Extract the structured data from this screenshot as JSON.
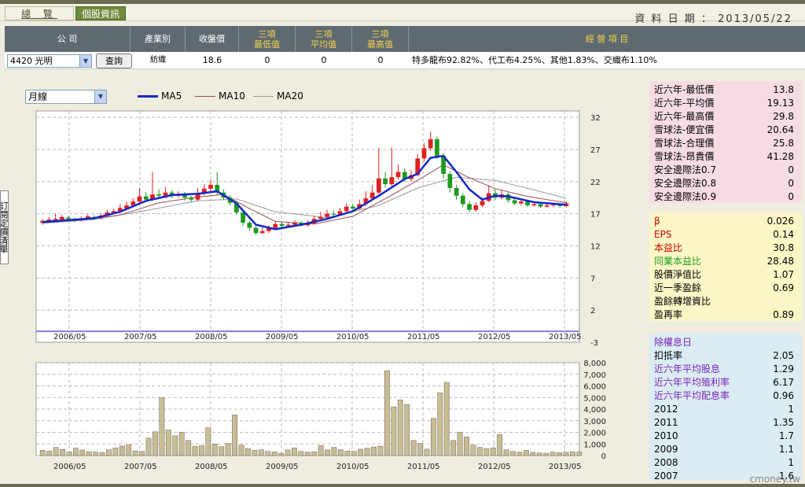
{
  "tabs": {
    "overview": "總 覽",
    "stock_info": "個股資訊"
  },
  "data_date_label": "資 料 日 期 ：",
  "data_date": "2013/05/22",
  "header": {
    "company": "公 司",
    "industry": "產業別",
    "close": "收盤價",
    "three_low": "三項\n最低值",
    "three_avg": "三項\n平均值",
    "three_high": "三項\n最高值",
    "business": "經 營 項 目"
  },
  "row": {
    "stock_select": "4420 光明",
    "query_button": "查詢",
    "industry": "紡織",
    "close": "18.6",
    "three_low": "0",
    "three_avg": "0",
    "three_high": "0",
    "business": "特多龍布92.82%、代工布4.25%、其他1.83%、交織布1.10%"
  },
  "left_tab": "訂閱定價清單",
  "period_select": "月線",
  "legend": [
    "MA5",
    "MA10",
    "MA20"
  ],
  "side": {
    "panel1": [
      {
        "label": "近六年-最低價",
        "value": "13.8"
      },
      {
        "label": "近六年-平均價",
        "value": "19.13"
      },
      {
        "label": "近六年-最高價",
        "value": "29.8"
      },
      {
        "label": "雪球法-便宜價",
        "value": "20.64"
      },
      {
        "label": "雪球法-合理價",
        "value": "25.8"
      },
      {
        "label": "雪球法-昂貴價",
        "value": "41.28"
      },
      {
        "label": "安全邊際法0.7",
        "value": "0"
      },
      {
        "label": "安全邊際法0.8",
        "value": "0"
      },
      {
        "label": "安全邊際法0.9",
        "value": "0"
      }
    ],
    "panel2": [
      {
        "label": "β",
        "value": "0.026"
      },
      {
        "label": "EPS",
        "value": "0.14"
      },
      {
        "label": "本益比",
        "value": "30.8"
      },
      {
        "label": "同業本益比",
        "value": "28.48"
      },
      {
        "label": "股價淨值比",
        "value": "1.07"
      },
      {
        "label": "近一季盈餘",
        "value": "0.69"
      },
      {
        "label": "盈餘轉增資比",
        "value": ""
      },
      {
        "label": "盈再率",
        "value": "0.89"
      }
    ],
    "panel3_title": "除權息日",
    "panel3": [
      {
        "label": "扣抵率",
        "value": "2.05"
      },
      {
        "label": "近六年平均股息",
        "value": "1.29"
      },
      {
        "label": "近六年平均殖利率",
        "value": "6.17"
      },
      {
        "label": "近六年平均配息率",
        "value": "0.96"
      },
      {
        "label": "2012",
        "value": "1"
      },
      {
        "label": "2011",
        "value": "1.35"
      },
      {
        "label": "2010",
        "value": "1.7"
      },
      {
        "label": "2009",
        "value": "1.1"
      },
      {
        "label": "2008",
        "value": "1"
      },
      {
        "label": "2007",
        "value": "1.6"
      }
    ]
  },
  "colors": {
    "label_red": "#cc0000",
    "label_green": "#22a022",
    "label_purple": "#7a22b8",
    "up": "#e02020",
    "down": "#1f9a1f",
    "ma5": "#1428c8",
    "ma10": "#9a4e52",
    "ma20": "#9a9a9a",
    "volume": "#c8bd96"
  },
  "watermark": "cmoney.tw",
  "chart_data": [
    {
      "type": "candlestick",
      "x_ticks": [
        "2006/05",
        "2007/05",
        "2008/05",
        "2009/05",
        "2010/05",
        "2011/05",
        "2012/05",
        "2013/05"
      ],
      "y_ticks": [
        32,
        27,
        22,
        17,
        12,
        7,
        2,
        -3
      ],
      "ylim": [
        -3,
        33
      ],
      "xlim": [
        0,
        84
      ],
      "legend_placement": "top-left",
      "grid": true,
      "candles": [
        [
          0,
          15.6,
          15.9,
          15.3,
          16.2
        ],
        [
          1,
          15.8,
          16.1,
          15.6,
          16.5
        ],
        [
          2,
          16.0,
          16.2,
          15.8,
          17.0
        ],
        [
          3,
          16.1,
          16.5,
          15.9,
          16.8
        ],
        [
          4,
          16.4,
          16.2,
          16.0,
          16.7
        ],
        [
          5,
          16.2,
          16.0,
          15.7,
          16.4
        ],
        [
          6,
          16.0,
          16.3,
          15.8,
          16.6
        ],
        [
          7,
          16.3,
          16.6,
          16.1,
          16.9
        ],
        [
          8,
          16.5,
          16.3,
          16.1,
          16.8
        ],
        [
          9,
          16.3,
          16.7,
          16.1,
          17.1
        ],
        [
          10,
          16.7,
          17.2,
          16.5,
          17.6
        ],
        [
          11,
          17.1,
          17.4,
          16.9,
          17.8
        ],
        [
          12,
          17.4,
          17.9,
          17.2,
          18.5
        ],
        [
          13,
          17.8,
          18.3,
          17.6,
          18.9
        ],
        [
          14,
          18.3,
          18.9,
          18.1,
          19.4
        ],
        [
          15,
          18.9,
          19.7,
          18.7,
          21.0
        ],
        [
          16,
          19.7,
          19.2,
          18.9,
          20.4
        ],
        [
          17,
          19.2,
          20.0,
          19.0,
          23.5
        ],
        [
          18,
          20.0,
          19.8,
          19.5,
          20.8
        ],
        [
          19,
          19.8,
          20.3,
          19.4,
          21.2
        ],
        [
          20,
          20.3,
          19.8,
          19.4,
          20.7
        ],
        [
          21,
          19.8,
          20.1,
          19.5,
          20.5
        ],
        [
          22,
          20.1,
          19.5,
          19.1,
          20.4
        ],
        [
          23,
          19.5,
          19.2,
          18.8,
          19.8
        ],
        [
          24,
          19.2,
          20.2,
          19.0,
          21.0
        ],
        [
          25,
          20.2,
          20.9,
          19.9,
          21.6
        ],
        [
          26,
          20.9,
          21.5,
          20.4,
          22.3
        ],
        [
          27,
          21.5,
          20.3,
          19.9,
          23.5
        ],
        [
          28,
          20.3,
          19.5,
          19.1,
          20.8
        ],
        [
          29,
          19.5,
          18.7,
          18.3,
          19.9
        ],
        [
          30,
          18.7,
          17.2,
          16.8,
          19.0
        ],
        [
          31,
          17.2,
          15.6,
          15.1,
          17.5
        ],
        [
          32,
          15.6,
          14.8,
          14.3,
          15.9
        ],
        [
          33,
          14.8,
          14.0,
          13.6,
          15.1
        ],
        [
          34,
          14.0,
          14.3,
          13.8,
          14.9
        ],
        [
          35,
          14.3,
          14.8,
          14.0,
          15.2
        ],
        [
          36,
          14.8,
          15.4,
          14.6,
          15.8
        ],
        [
          37,
          15.4,
          15.1,
          14.8,
          15.7
        ],
        [
          38,
          15.1,
          15.3,
          14.9,
          15.7
        ],
        [
          39,
          15.3,
          15.6,
          15.1,
          16.0
        ],
        [
          40,
          15.6,
          15.2,
          15.0,
          15.9
        ],
        [
          41,
          15.2,
          15.5,
          15.0,
          16.0
        ],
        [
          42,
          15.5,
          16.2,
          15.3,
          16.7
        ],
        [
          43,
          16.2,
          16.5,
          15.9,
          17.3
        ],
        [
          44,
          16.5,
          17.0,
          16.2,
          17.6
        ],
        [
          45,
          17.0,
          16.9,
          16.6,
          17.5
        ],
        [
          46,
          16.9,
          17.4,
          16.7,
          17.9
        ],
        [
          47,
          17.4,
          18.1,
          17.2,
          18.6
        ],
        [
          48,
          18.1,
          17.8,
          17.5,
          18.5
        ],
        [
          49,
          17.8,
          18.5,
          17.6,
          19.2
        ],
        [
          50,
          18.5,
          19.4,
          18.2,
          20.5
        ],
        [
          51,
          19.4,
          20.3,
          19.1,
          21.5
        ],
        [
          52,
          20.3,
          22.5,
          20.0,
          27.2
        ],
        [
          53,
          22.5,
          21.6,
          21.1,
          23.5
        ],
        [
          54,
          21.6,
          22.7,
          21.3,
          27.3
        ],
        [
          55,
          22.7,
          23.5,
          22.3,
          24.6
        ],
        [
          56,
          23.5,
          22.4,
          22.0,
          24.1
        ],
        [
          57,
          22.4,
          23.0,
          22.1,
          23.8
        ],
        [
          58,
          23.0,
          25.6,
          22.8,
          26.3
        ],
        [
          59,
          25.6,
          27.2,
          25.1,
          28.0
        ],
        [
          60,
          27.2,
          28.6,
          26.8,
          29.8
        ],
        [
          61,
          28.6,
          26.0,
          25.5,
          29.0
        ],
        [
          62,
          26.0,
          23.2,
          22.5,
          26.4
        ],
        [
          63,
          23.2,
          21.0,
          20.3,
          23.6
        ],
        [
          64,
          21.0,
          19.8,
          19.2,
          21.5
        ],
        [
          65,
          19.8,
          18.5,
          18.0,
          20.2
        ],
        [
          66,
          18.5,
          17.6,
          17.2,
          19.0
        ],
        [
          67,
          17.6,
          18.3,
          17.3,
          18.8
        ],
        [
          68,
          18.3,
          19.0,
          18.0,
          19.6
        ],
        [
          69,
          19.0,
          20.2,
          18.8,
          21.4
        ],
        [
          70,
          20.2,
          19.5,
          19.1,
          20.8
        ],
        [
          71,
          19.5,
          20.0,
          19.2,
          20.6
        ],
        [
          72,
          20.0,
          19.1,
          18.7,
          20.3
        ],
        [
          73,
          19.1,
          18.6,
          18.3,
          19.4
        ],
        [
          74,
          18.6,
          18.9,
          18.4,
          19.3
        ],
        [
          75,
          18.9,
          18.3,
          18.0,
          19.2
        ],
        [
          76,
          18.3,
          18.5,
          18.1,
          18.9
        ],
        [
          77,
          18.5,
          18.1,
          17.9,
          18.8
        ],
        [
          78,
          18.1,
          18.3,
          17.9,
          18.6
        ],
        [
          79,
          18.3,
          18.4,
          18.0,
          18.7
        ],
        [
          80,
          18.4,
          18.2,
          17.9,
          18.6
        ],
        [
          81,
          18.2,
          18.6,
          18.0,
          18.9
        ]
      ],
      "ma5": [
        [
          0,
          15.7
        ],
        [
          4,
          16.0
        ],
        [
          8,
          16.3
        ],
        [
          12,
          17.3
        ],
        [
          16,
          19.0
        ],
        [
          20,
          19.9
        ],
        [
          24,
          20.1
        ],
        [
          27,
          20.5
        ],
        [
          30,
          18.6
        ],
        [
          33,
          15.3
        ],
        [
          36,
          14.6
        ],
        [
          40,
          15.3
        ],
        [
          44,
          16.2
        ],
        [
          48,
          17.4
        ],
        [
          52,
          19.8
        ],
        [
          56,
          22.4
        ],
        [
          58,
          23.2
        ],
        [
          60,
          25.7
        ],
        [
          62,
          26.0
        ],
        [
          64,
          23.5
        ],
        [
          66,
          20.8
        ],
        [
          68,
          19.2
        ],
        [
          70,
          19.8
        ],
        [
          72,
          19.7
        ],
        [
          76,
          18.8
        ],
        [
          81,
          18.4
        ]
      ],
      "ma10": [
        [
          0,
          15.6
        ],
        [
          6,
          16.0
        ],
        [
          12,
          16.8
        ],
        [
          18,
          18.7
        ],
        [
          24,
          19.6
        ],
        [
          28,
          20.0
        ],
        [
          32,
          17.8
        ],
        [
          36,
          15.8
        ],
        [
          42,
          15.4
        ],
        [
          48,
          16.6
        ],
        [
          54,
          19.9
        ],
        [
          58,
          22.2
        ],
        [
          62,
          24.6
        ],
        [
          66,
          22.6
        ],
        [
          70,
          20.9
        ],
        [
          75,
          19.7
        ],
        [
          81,
          18.7
        ]
      ],
      "ma20": [
        [
          0,
          15.5
        ],
        [
          8,
          16.1
        ],
        [
          16,
          17.5
        ],
        [
          24,
          19.0
        ],
        [
          30,
          19.3
        ],
        [
          36,
          17.3
        ],
        [
          44,
          16.4
        ],
        [
          52,
          18.3
        ],
        [
          58,
          21.0
        ],
        [
          64,
          22.7
        ],
        [
          70,
          22.2
        ],
        [
          76,
          20.7
        ],
        [
          81,
          19.4
        ]
      ]
    },
    {
      "type": "bar",
      "x_ticks": [
        "2006/05",
        "2007/05",
        "2008/05",
        "2009/05",
        "2010/05",
        "2011/05",
        "2012/05",
        "2013/05"
      ],
      "y_ticks": [
        "8,000",
        "7,000",
        "6,000",
        "5,000",
        "4,000",
        "3,000",
        "2,000",
        "1,000",
        "0"
      ],
      "ylim": [
        0,
        8000
      ],
      "grid": true,
      "values": [
        450,
        380,
        700,
        520,
        300,
        640,
        480,
        340,
        300,
        270,
        500,
        650,
        820,
        920,
        400,
        360,
        1500,
        2050,
        4980,
        2200,
        1700,
        2000,
        1300,
        800,
        850,
        2400,
        1000,
        780,
        1050,
        3500,
        900,
        600,
        450,
        500,
        360,
        320,
        200,
        480,
        650,
        360,
        300,
        320,
        860,
        480,
        700,
        500,
        380,
        360,
        540,
        620,
        740,
        800,
        7300,
        4200,
        4800,
        4400,
        1300,
        1050,
        550,
        3200,
        5400,
        6300,
        1300,
        2000,
        1600,
        900,
        700,
        600,
        650,
        1800,
        500,
        350,
        300,
        450,
        280,
        230,
        200,
        300,
        250,
        280,
        320,
        300
      ]
    }
  ]
}
